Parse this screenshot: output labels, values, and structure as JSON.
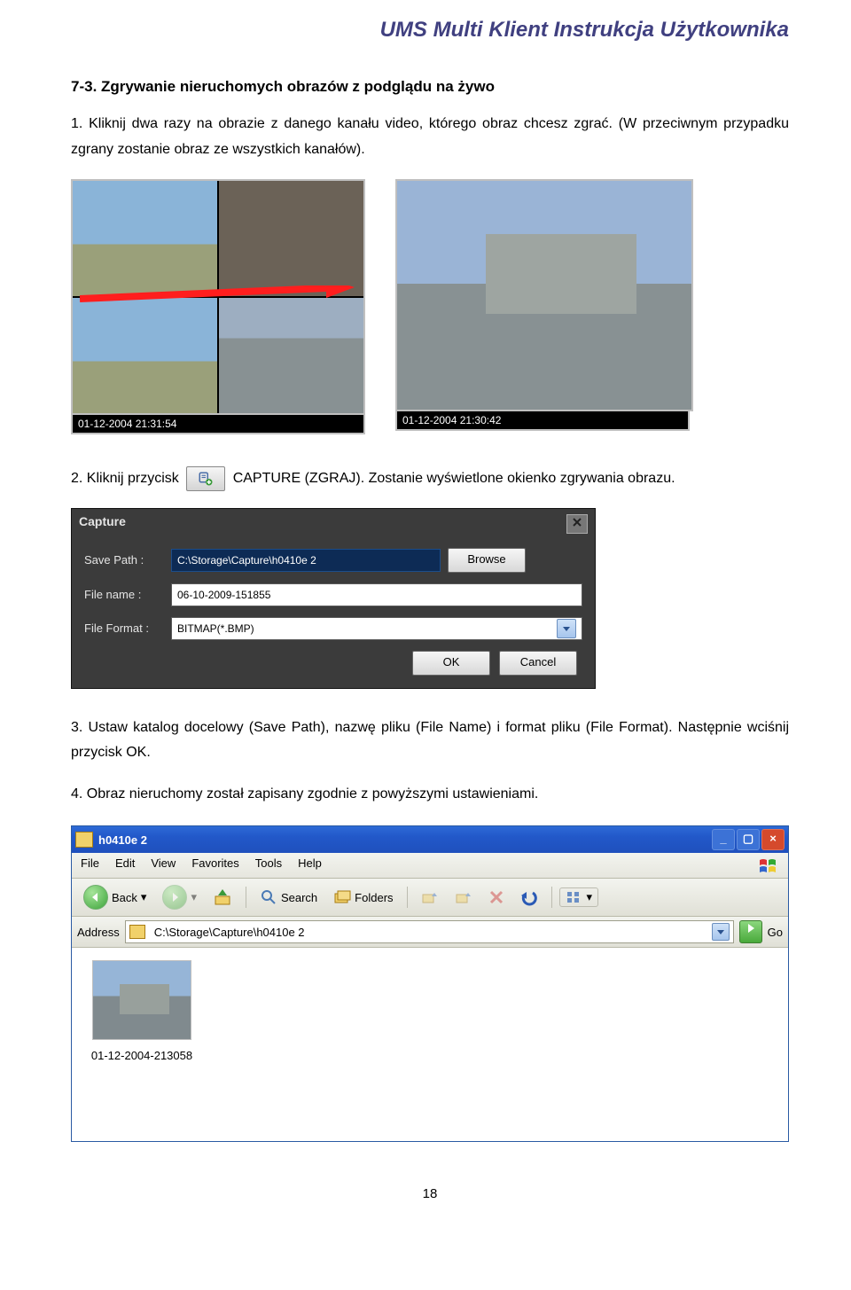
{
  "header": {
    "title": "UMS Multi Klient Instrukcja Użytkownika"
  },
  "section": {
    "heading": "7-3. Zgrywanie nieruchomych obrazów z podglądu na żywo"
  },
  "para1": "1. Kliknij dwa razy na obrazie z danego kanału video, którego obraz chcesz zgrać. (W przeciwnym przypadku zgrany zostanie obraz ze wszystkich kanałów).",
  "cams": {
    "ts_left": "01-12-2004 21:31:54",
    "ts_right": "01-12-2004 21:30:42"
  },
  "para2_a": "2. Kliknij przycisk ",
  "para2_b": " CAPTURE (ZGRAJ). Zostanie wyświetlone okienko zgrywania obrazu.",
  "capture_dialog": {
    "title": "Capture",
    "save_path_label": "Save Path :",
    "save_path_value": "C:\\Storage\\Capture\\h0410e 2",
    "browse": "Browse",
    "file_name_label": "File name :",
    "file_name_value": "06-10-2009-151855",
    "file_format_label": "File Format :",
    "file_format_value": "BITMAP(*.BMP)",
    "ok": "OK",
    "cancel": "Cancel"
  },
  "para3": "3. Ustaw katalog docelowy (Save Path), nazwę pliku (File Name) i format pliku (File Format). Następnie wciśnij przycisk OK.",
  "para4": "4. Obraz nieruchomy został zapisany zgodnie z powyższymi ustawieniami.",
  "explorer": {
    "title": "h0410e 2",
    "menu": [
      "File",
      "Edit",
      "View",
      "Favorites",
      "Tools",
      "Help"
    ],
    "back": "Back",
    "search": "Search",
    "folders": "Folders",
    "address_label": "Address",
    "address_value": "C:\\Storage\\Capture\\h0410e 2",
    "go": "Go",
    "thumb_caption": "01-12-2004-213058"
  },
  "page_number": "18"
}
